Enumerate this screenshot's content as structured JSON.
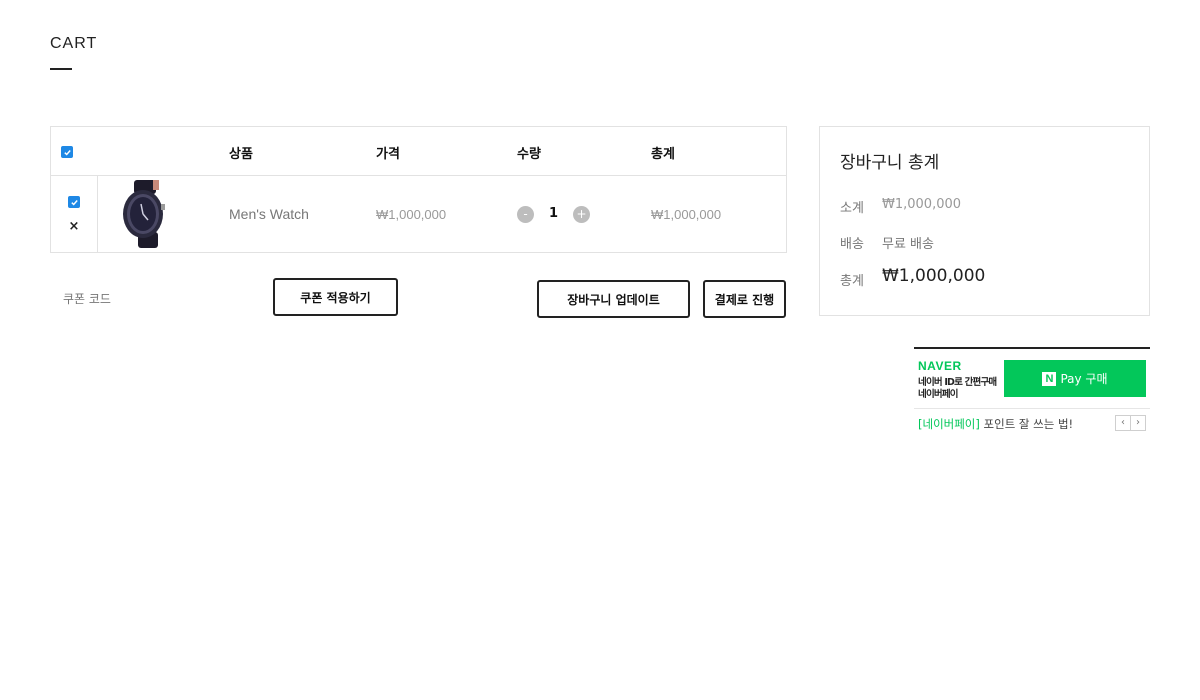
{
  "page": {
    "title": "CART"
  },
  "table": {
    "headers": {
      "product": "상품",
      "price": "가격",
      "quantity": "수량",
      "total": "총계"
    },
    "rows": [
      {
        "name": "Men's Watch",
        "price": "₩1,000,000",
        "quantity": "1",
        "total": "₩1,000,000"
      }
    ]
  },
  "icons": {
    "remove": "×",
    "minus": "-",
    "plus": "+",
    "checkbox": "check-icon",
    "prev": "‹",
    "next": "›"
  },
  "coupon": {
    "label": "쿠폰 코드",
    "apply_label": "쿠폰 적용하기"
  },
  "actions": {
    "update_label": "장바구니 업데이트",
    "checkout_label": "결제로 진행"
  },
  "totals": {
    "title": "장바구니 총계",
    "subtotal_label": "소계",
    "subtotal_value": "₩1,000,000",
    "shipping_label": "배송",
    "shipping_value": "무료 배송",
    "total_label": "총계",
    "total_value": "₩1,000,000"
  },
  "naver_pay": {
    "brand": "NAVER",
    "line1": "네이버 ID로 간편구매",
    "line2": "네이버페이",
    "button_label": "Pay 구매",
    "button_mark": "N",
    "link_tag": "[네이버페이]",
    "link_text": "포인트 잘 쓰는 법!"
  },
  "colors": {
    "checkbox": "#1e88e5",
    "naver_green": "#03c75a",
    "border": "#e2e2e2"
  }
}
